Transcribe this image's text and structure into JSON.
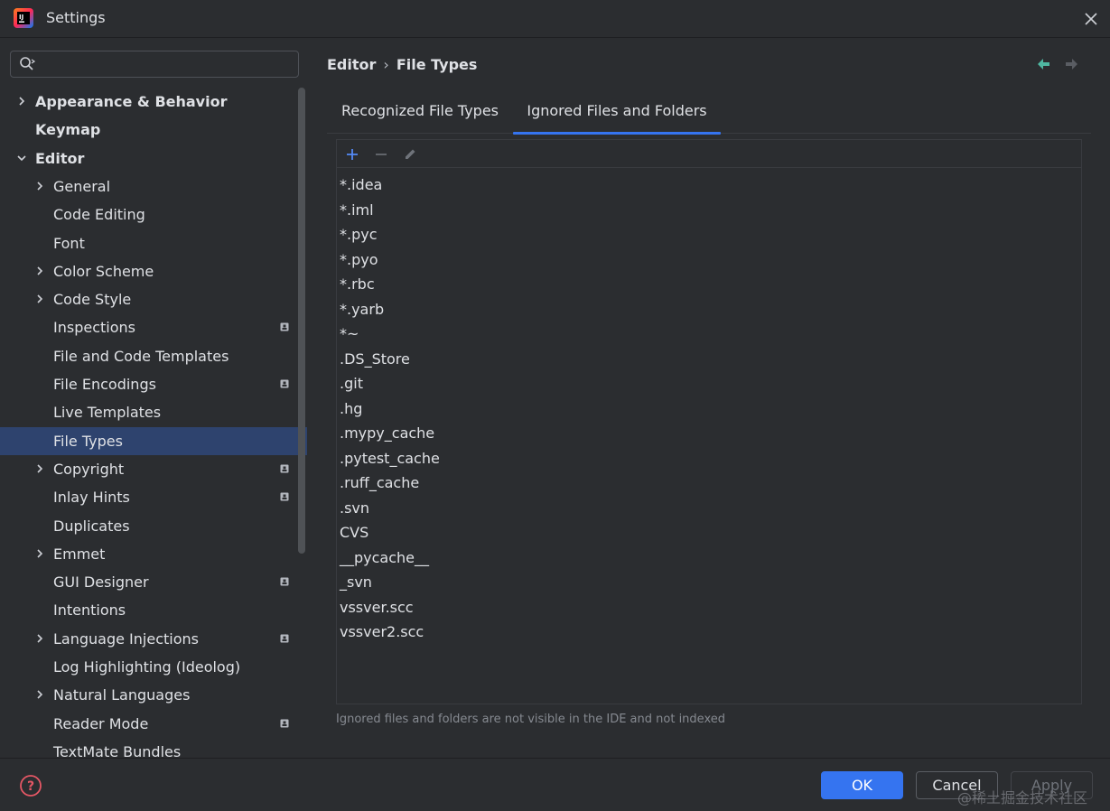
{
  "window": {
    "title": "Settings"
  },
  "search": {
    "value": "",
    "placeholder": ""
  },
  "tree": [
    {
      "label": "Appearance & Behavior",
      "level": 0,
      "expandable": true,
      "expanded": false,
      "bold": true,
      "project": false,
      "selected": false
    },
    {
      "label": "Keymap",
      "level": 0,
      "expandable": false,
      "expanded": false,
      "bold": true,
      "project": false,
      "selected": false
    },
    {
      "label": "Editor",
      "level": 0,
      "expandable": true,
      "expanded": true,
      "bold": true,
      "project": false,
      "selected": false
    },
    {
      "label": "General",
      "level": 1,
      "expandable": true,
      "expanded": false,
      "bold": false,
      "project": false,
      "selected": false
    },
    {
      "label": "Code Editing",
      "level": 1,
      "expandable": false,
      "expanded": false,
      "bold": false,
      "project": false,
      "selected": false
    },
    {
      "label": "Font",
      "level": 1,
      "expandable": false,
      "expanded": false,
      "bold": false,
      "project": false,
      "selected": false
    },
    {
      "label": "Color Scheme",
      "level": 1,
      "expandable": true,
      "expanded": false,
      "bold": false,
      "project": false,
      "selected": false
    },
    {
      "label": "Code Style",
      "level": 1,
      "expandable": true,
      "expanded": false,
      "bold": false,
      "project": false,
      "selected": false
    },
    {
      "label": "Inspections",
      "level": 1,
      "expandable": false,
      "expanded": false,
      "bold": false,
      "project": true,
      "selected": false
    },
    {
      "label": "File and Code Templates",
      "level": 1,
      "expandable": false,
      "expanded": false,
      "bold": false,
      "project": false,
      "selected": false
    },
    {
      "label": "File Encodings",
      "level": 1,
      "expandable": false,
      "expanded": false,
      "bold": false,
      "project": true,
      "selected": false
    },
    {
      "label": "Live Templates",
      "level": 1,
      "expandable": false,
      "expanded": false,
      "bold": false,
      "project": false,
      "selected": false
    },
    {
      "label": "File Types",
      "level": 1,
      "expandable": false,
      "expanded": false,
      "bold": false,
      "project": false,
      "selected": true
    },
    {
      "label": "Copyright",
      "level": 1,
      "expandable": true,
      "expanded": false,
      "bold": false,
      "project": true,
      "selected": false
    },
    {
      "label": "Inlay Hints",
      "level": 1,
      "expandable": false,
      "expanded": false,
      "bold": false,
      "project": true,
      "selected": false
    },
    {
      "label": "Duplicates",
      "level": 1,
      "expandable": false,
      "expanded": false,
      "bold": false,
      "project": false,
      "selected": false
    },
    {
      "label": "Emmet",
      "level": 1,
      "expandable": true,
      "expanded": false,
      "bold": false,
      "project": false,
      "selected": false
    },
    {
      "label": "GUI Designer",
      "level": 1,
      "expandable": false,
      "expanded": false,
      "bold": false,
      "project": true,
      "selected": false
    },
    {
      "label": "Intentions",
      "level": 1,
      "expandable": false,
      "expanded": false,
      "bold": false,
      "project": false,
      "selected": false
    },
    {
      "label": "Language Injections",
      "level": 1,
      "expandable": true,
      "expanded": false,
      "bold": false,
      "project": true,
      "selected": false
    },
    {
      "label": "Log Highlighting (Ideolog)",
      "level": 1,
      "expandable": false,
      "expanded": false,
      "bold": false,
      "project": false,
      "selected": false
    },
    {
      "label": "Natural Languages",
      "level": 1,
      "expandable": true,
      "expanded": false,
      "bold": false,
      "project": false,
      "selected": false
    },
    {
      "label": "Reader Mode",
      "level": 1,
      "expandable": false,
      "expanded": false,
      "bold": false,
      "project": true,
      "selected": false
    },
    {
      "label": "TextMate Bundles",
      "level": 1,
      "expandable": false,
      "expanded": false,
      "bold": false,
      "project": false,
      "selected": false
    }
  ],
  "breadcrumb": {
    "parent": "Editor",
    "separator": "›",
    "current": "File Types"
  },
  "tabs": [
    {
      "label": "Recognized File Types",
      "active": false
    },
    {
      "label": "Ignored Files and Folders",
      "active": true
    }
  ],
  "toolbar": {
    "add_icon": "plus-icon",
    "remove_icon": "minus-icon",
    "edit_icon": "pencil-icon"
  },
  "ignored_items": [
    "*.idea",
    "*.iml",
    "*.pyc",
    "*.pyo",
    "*.rbc",
    "*.yarb",
    "*~",
    ".DS_Store",
    ".git",
    ".hg",
    ".mypy_cache",
    ".pytest_cache",
    ".ruff_cache",
    ".svn",
    "CVS",
    "__pycache__",
    "_svn",
    "vssver.scc",
    "vssver2.scc"
  ],
  "hint": "Ignored files and folders are not visible in the IDE and not indexed",
  "buttons": {
    "ok": "OK",
    "cancel": "Cancel",
    "apply": "Apply"
  },
  "watermark": "@稀土掘金技术社区",
  "colors": {
    "accent": "#3574f0",
    "selection": "#2e436e",
    "background": "#2b2d30",
    "nav_arrow_active": "#4fb8a2"
  }
}
